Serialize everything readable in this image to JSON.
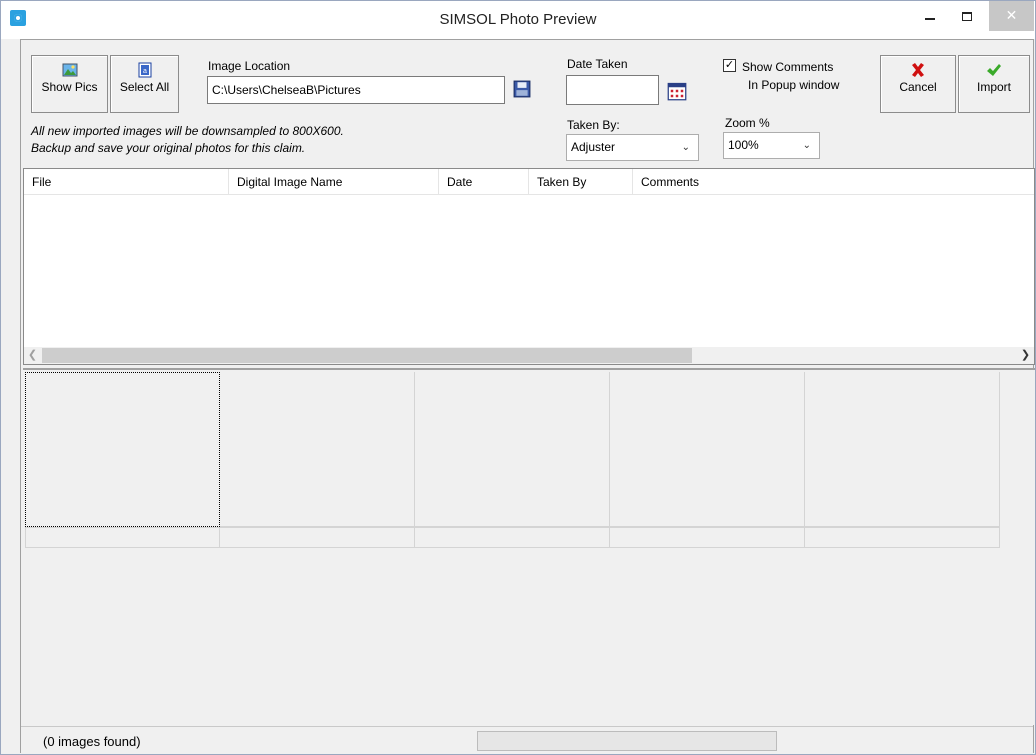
{
  "window": {
    "title": "SIMSOL Photo Preview",
    "minimize_glyph": "",
    "close_glyph": "✕"
  },
  "toolbar": {
    "show_pics_label": "Show Pics",
    "select_all_label": "Select All",
    "cancel_label": "Cancel",
    "import_label": "Import"
  },
  "image_location": {
    "label": "Image Location",
    "value": "C:\\Users\\ChelseaB\\Pictures"
  },
  "notes": {
    "line1": "All new imported images will be downsampled to 800X600.",
    "line2": "Backup and save your original photos for this claim."
  },
  "date_taken": {
    "label": "Date Taken",
    "value": ""
  },
  "taken_by": {
    "label": "Taken By:",
    "selected": "Adjuster"
  },
  "show_comments": {
    "label_line1": "Show Comments",
    "label_line2": "In Popup window",
    "checked": true,
    "check_glyph": "✓"
  },
  "zoom": {
    "label": "Zoom %",
    "selected": "100%"
  },
  "listview": {
    "columns": [
      "File",
      "Digital Image Name",
      "Date",
      "Taken By",
      "Comments"
    ],
    "rows": []
  },
  "status": {
    "text": "(0 images found)"
  },
  "icons": {
    "app": "app-eye-icon",
    "show_pics": "picture-icon",
    "select_all": "select-all-icon",
    "save": "floppy-disk-icon",
    "calendar": "calendar-icon",
    "cancel": "red-x-icon",
    "import": "green-check-icon"
  },
  "colors": {
    "cancel_icon": "#d01010",
    "import_icon": "#3aaa2a",
    "close_button": "#c7c7c7",
    "app_icon": "#2aa1e0"
  }
}
